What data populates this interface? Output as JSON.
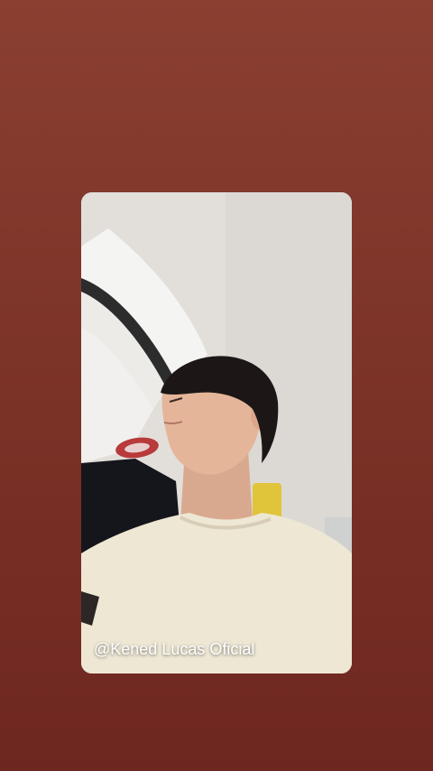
{
  "story": {
    "caption": "@Kened Lucas Oficial"
  },
  "colors": {
    "background": "#7e3428",
    "ceiling": "#e4e1dd",
    "shirt": "#efe8d6",
    "hair": "#1c1716"
  }
}
